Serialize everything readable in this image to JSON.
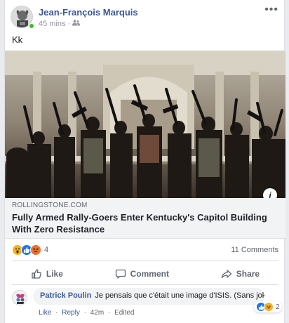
{
  "post": {
    "author": "Jean-François Marquis",
    "time": "45 mins",
    "separator": "·",
    "audience_icon": "friends-icon",
    "more_icon": "•••",
    "text": "Kk"
  },
  "link": {
    "domain": "ROLLINGSTONE.COM",
    "headline": "Fully Armed Rally-Goers Enter Kentucky's Capitol Building With Zero Resistance",
    "info_icon": "i"
  },
  "stats": {
    "reactions": [
      "wow",
      "like",
      "angry"
    ],
    "reaction_count": "4",
    "comments": "11 Comments"
  },
  "actions": {
    "like": "Like",
    "comment": "Comment",
    "share": "Share"
  },
  "comment": {
    "author": "Patrick Poulin",
    "text": "Je pensais que c'était une image d'ISIS. (Sans joke.)",
    "reaction_count": "2",
    "like": "Like",
    "reply": "Reply",
    "time": "42m",
    "edited": "Edited",
    "dot": "·"
  },
  "colors": {
    "brand_link": "#385898",
    "like_blue": "#1877f2",
    "angry_orange": "#f0702b",
    "wow_yellow": "#f7b125"
  }
}
